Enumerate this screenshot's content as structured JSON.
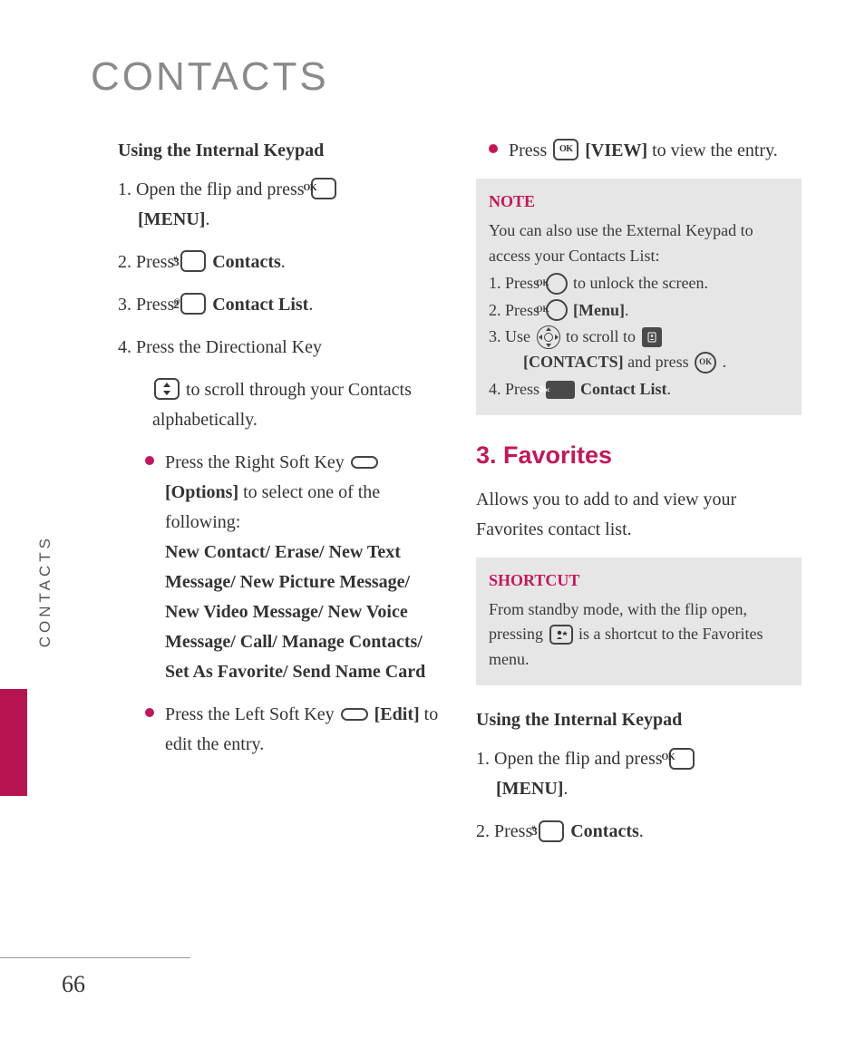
{
  "page_title": "CONTACTS",
  "side_tab": "CONTACTS",
  "page_number": "66",
  "left": {
    "subheading": "Using the Internal Keypad",
    "step1_a": "1. Open the flip and press ",
    "step1_b": "[MENU]",
    "step1_c": ".",
    "step2_a": "2. Press ",
    "step2_b": "Contacts",
    "step2_c": ".",
    "step3_a": "3. Press ",
    "step3_b": "Contact List",
    "step3_c": ".",
    "step4_a": "4. Press the Directional Key",
    "step4_b": " to scroll through your Contacts alphabetically.",
    "bullet1_a": "Press the Right Soft Key ",
    "bullet1_b": "[Options]",
    "bullet1_c": " to select one of the following:",
    "bullet1_list": "New Contact/ Erase/ New Text Message/ New Picture Message/ New Video Message/ New Voice Message/ Call/ Manage Contacts/ Set As Favorite/ Send Name Card",
    "bullet2_a": "Press the Left Soft Key ",
    "bullet2_b": "[Edit]",
    "bullet2_c": " to edit the entry."
  },
  "right": {
    "bullet3_a": "Press ",
    "bullet3_b": "[VIEW]",
    "bullet3_c": " to view the entry.",
    "note_title": "NOTE",
    "note_intro": "You can also use the External Keypad to access your Contacts List:",
    "note_s1_a": "1. Press ",
    "note_s1_b": " to unlock the screen.",
    "note_s2_a": "2. Press ",
    "note_s2_b": "[Menu]",
    "note_s2_c": ".",
    "note_s3_a": "3. Use ",
    "note_s3_b": " to scroll to ",
    "note_s3_c": "[CONTACTS]",
    "note_s3_d": " and press ",
    "note_s3_e": ".",
    "note_s4_a": "4. Press ",
    "note_s4_b": "Contact List",
    "note_s4_c": ".",
    "section_heading": "3. Favorites",
    "section_para": "Allows you to add to and view your Favorites contact list.",
    "shortcut_title": "SHORTCUT",
    "shortcut_a": "From standby mode, with the flip open, pressing ",
    "shortcut_b": " is a shortcut to the Favorites menu.",
    "sub2": "Using the Internal Keypad",
    "r_step1_a": "1. Open the flip and press ",
    "r_step1_b": "[MENU]",
    "r_step1_c": ".",
    "r_step2_a": "2. Press ",
    "r_step2_b": "Contacts",
    "r_step2_c": "."
  },
  "icons": {
    "ok": "OK",
    "key3": "3",
    "key3sup": "#",
    "key2": "2",
    "key2sup": "@",
    "key2abc_a": "2",
    "key2abc_b": "abc"
  }
}
